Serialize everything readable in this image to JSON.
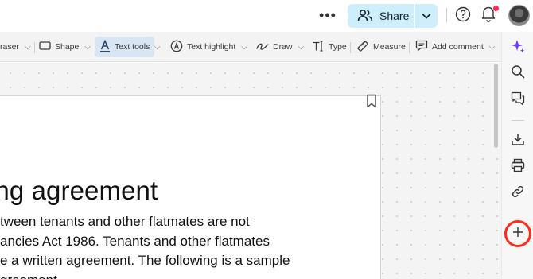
{
  "header": {
    "more_label": "•••",
    "share_label": "Share",
    "notification_badge_color": "#ff2d55",
    "share_color": "#cfeefb"
  },
  "toolbar": {
    "eraser": "raser",
    "shape": "Shape",
    "text_tools": "Text tools",
    "text_highlight": "Text highlight",
    "draw": "Draw",
    "type": "Type",
    "measure": "Measure",
    "add_comment": "Add comment"
  },
  "document": {
    "heading": "ing agreement",
    "body_lines": [
      "tween tenants and other flatmates are not",
      "ancies Act 1986. Tenants and other flatmates",
      "e a written agreement. The following is a sample",
      "greement"
    ]
  },
  "right_rail": {
    "icons": [
      "sparkle-icon",
      "search-icon",
      "comments-icon",
      "download-icon",
      "print-icon",
      "link-icon",
      "plus-icon"
    ],
    "highlight_color": "#ff2a1a"
  }
}
